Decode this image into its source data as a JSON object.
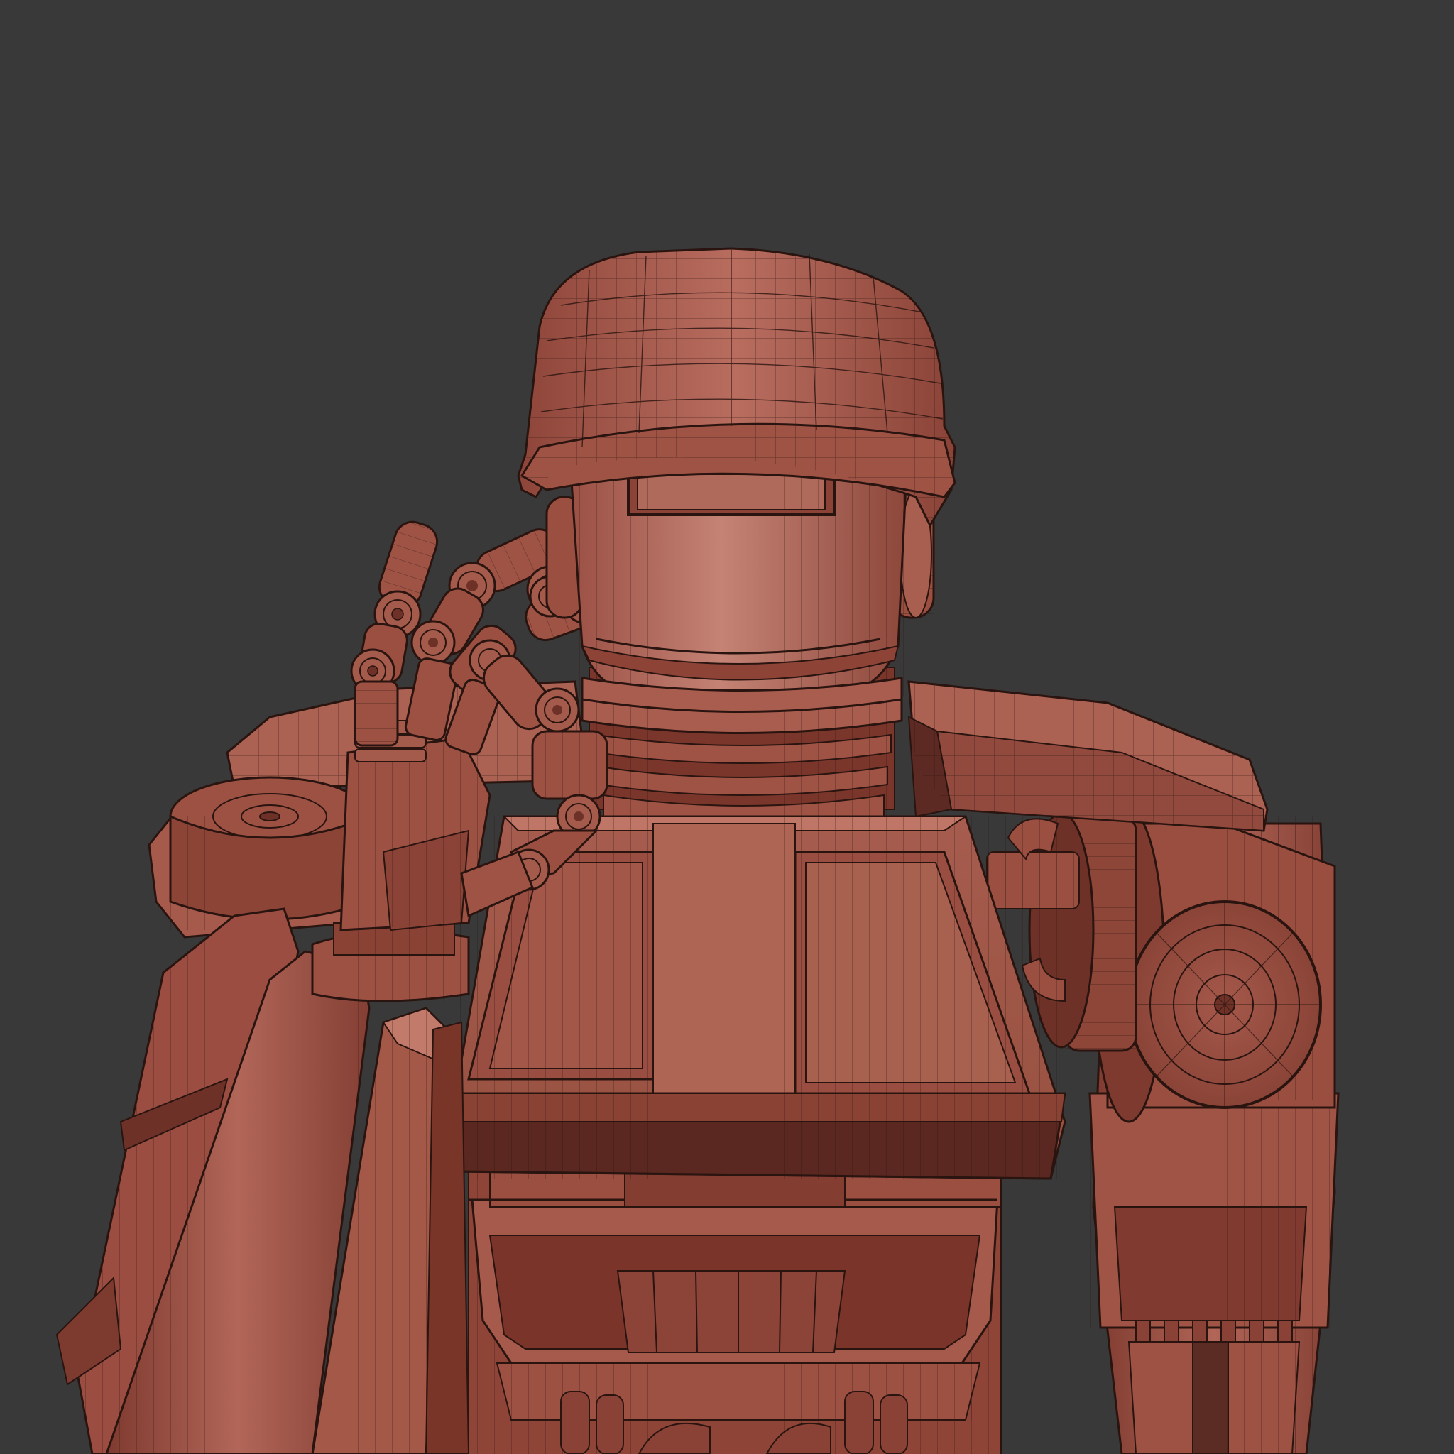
{
  "scene": {
    "background_color": "#393939",
    "subject": "robot-wireframe-model",
    "shading": {
      "base": "#a85a4c",
      "light": "#c27a6a",
      "mid": "#9a4e42",
      "dark": "#6e3128",
      "deep": "#4a2520",
      "wire": "#2a1410"
    }
  }
}
